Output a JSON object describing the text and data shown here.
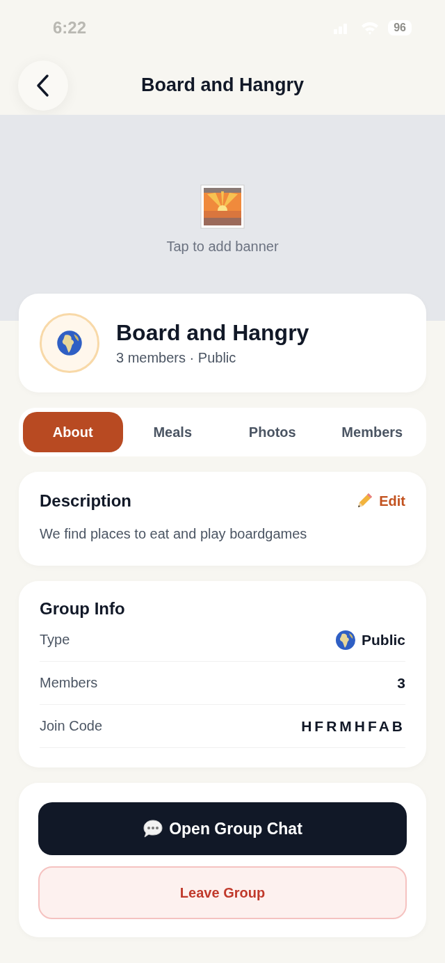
{
  "status_bar": {
    "time": "6:22",
    "battery": "96"
  },
  "header": {
    "title": "Board and Hangry"
  },
  "banner": {
    "hint": "Tap to add banner"
  },
  "profile": {
    "name": "Board and Hangry",
    "meta": "3 members · Public"
  },
  "tabs": [
    {
      "label": "About",
      "selected": true
    },
    {
      "label": "Meals",
      "selected": false
    },
    {
      "label": "Photos",
      "selected": false
    },
    {
      "label": "Members",
      "selected": false
    }
  ],
  "description": {
    "title": "Description",
    "edit": "Edit",
    "text": "We find places to eat and play boardgames"
  },
  "group_info": {
    "title": "Group Info",
    "rows": [
      {
        "label": "Type",
        "value": "Public",
        "kind": "globe"
      },
      {
        "label": "Members",
        "value": "3",
        "kind": "plain"
      },
      {
        "label": "Join Code",
        "value": "HFRMHFAB",
        "kind": "code"
      }
    ]
  },
  "actions": [
    {
      "label": "Open Group Chat",
      "kind": "primary"
    },
    {
      "label": "Leave Group",
      "kind": "danger"
    }
  ]
}
